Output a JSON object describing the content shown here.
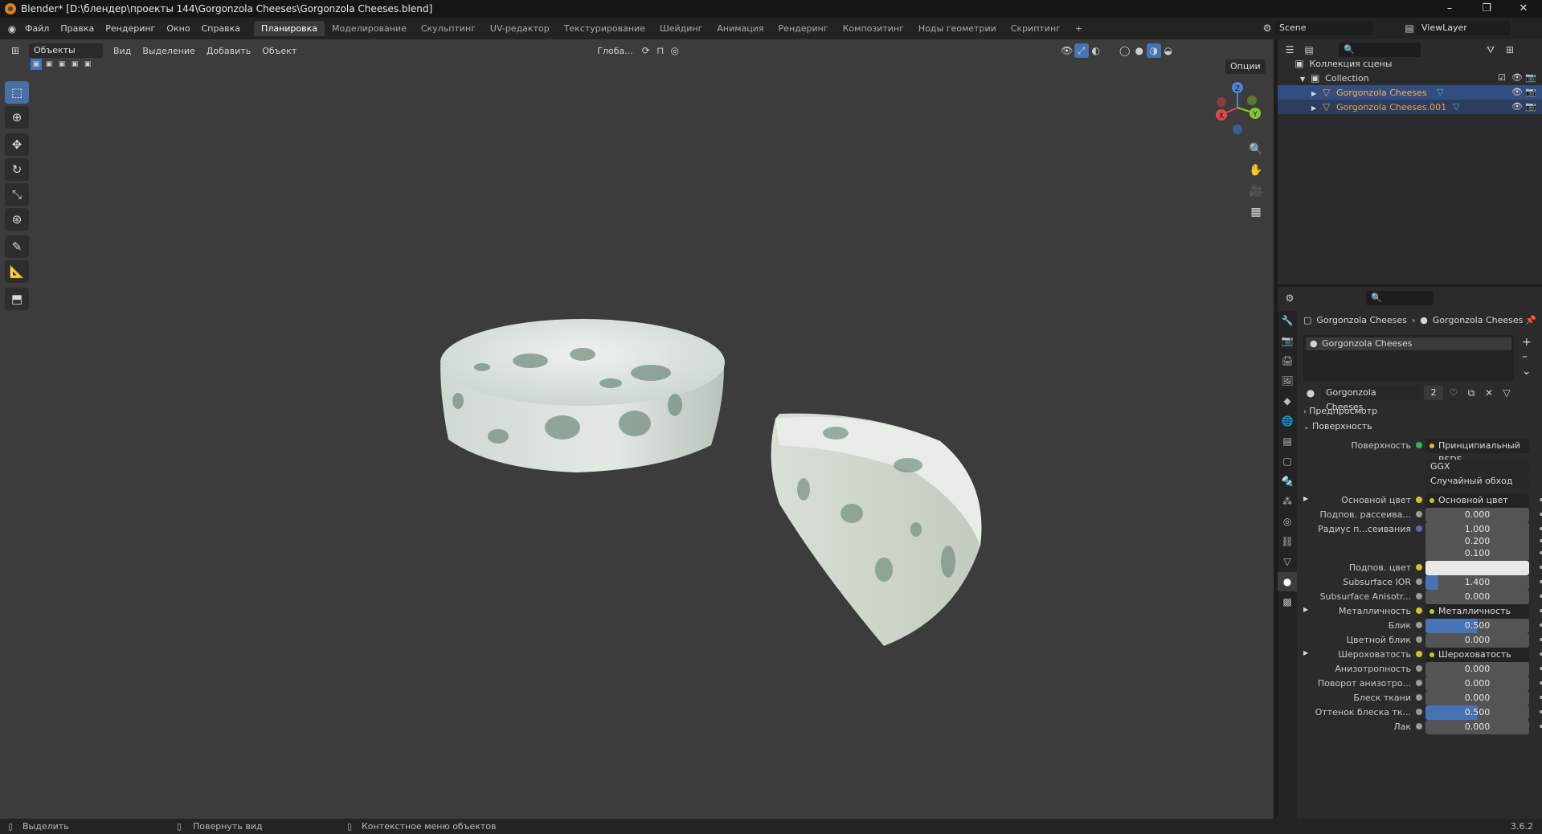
{
  "title": "Blender* [D:\\блендер\\проекты 144\\Gorgonzola Cheeses\\Gorgonzola Cheeses.blend]",
  "window_controls": {
    "minimize": "–",
    "restore": "❐",
    "close": "✕"
  },
  "menu": [
    "Файл",
    "Правка",
    "Рендеринг",
    "Окно",
    "Справка"
  ],
  "workspaces": [
    "Планировка",
    "Моделирование",
    "Скульптинг",
    "UV-редактор",
    "Текстурирование",
    "Шейдинг",
    "Анимация",
    "Рендеринг",
    "Композитинг",
    "Ноды геометрии",
    "Скриптинг",
    "+"
  ],
  "active_workspace": "Планировка",
  "scene": {
    "label": "Scene",
    "viewlayer": "ViewLayer"
  },
  "viewport": {
    "mode": "Объекты",
    "menu": [
      "Вид",
      "Выделение",
      "Добавить",
      "Объект"
    ],
    "orientation": "Глоба...",
    "options": "Опции",
    "gizmo_axes": {
      "z": "Z",
      "y": "Y",
      "x": "X"
    }
  },
  "outliner": {
    "root": "Коллекция сцены",
    "collection": "Collection",
    "objects": [
      "Gorgonzola Cheeses",
      "Gorgonzola Cheeses.001"
    ]
  },
  "properties": {
    "breadcrumb": [
      "Gorgonzola Cheeses",
      "Gorgonzola Cheeses"
    ],
    "material_slot": "Gorgonzola Cheeses",
    "material_name": "Gorgonzola Cheeses",
    "material_users": "2",
    "sections": {
      "preview": "Предпросмотр",
      "surface": "Поверхность"
    },
    "surface": {
      "label": "Поверхность",
      "value": "Принципиальный BSDF"
    },
    "distribution": "GGX",
    "subsurface_method": "Случайный обход",
    "rows": [
      {
        "label": "Основной цвет",
        "value": "Основной цвет",
        "kind": "node"
      },
      {
        "label": "Подпов. рассеива...",
        "value": "0.000",
        "kind": "num"
      },
      {
        "label": "Радиус п...сеивания",
        "value": "1.000",
        "kind": "num"
      },
      {
        "label": "",
        "value": "0.200",
        "kind": "num"
      },
      {
        "label": "",
        "value": "0.100",
        "kind": "num"
      },
      {
        "label": "Подпов. цвет",
        "value": "",
        "kind": "color"
      },
      {
        "label": "Subsurface IOR",
        "value": "1.400",
        "kind": "slider",
        "fill": 0.12
      },
      {
        "label": "Subsurface Anisotr...",
        "value": "0.000",
        "kind": "num"
      },
      {
        "label": "Металличность",
        "value": "Металличность",
        "kind": "node"
      },
      {
        "label": "Блик",
        "value": "0.500",
        "kind": "slider",
        "fill": 0.5
      },
      {
        "label": "Цветной блик",
        "value": "0.000",
        "kind": "num"
      },
      {
        "label": "Шероховатость",
        "value": "Шероховатость",
        "kind": "node"
      },
      {
        "label": "Анизотропность",
        "value": "0.000",
        "kind": "num"
      },
      {
        "label": "Поворот анизотро...",
        "value": "0.000",
        "kind": "num"
      },
      {
        "label": "Блеск ткани",
        "value": "0.000",
        "kind": "num"
      },
      {
        "label": "Оттенок блеска тк...",
        "value": "0.500",
        "kind": "slider",
        "fill": 0.5
      },
      {
        "label": "Лак",
        "value": "0.000",
        "kind": "num"
      }
    ]
  },
  "statusbar": {
    "select": "Выделить",
    "rotate": "Повернуть вид",
    "context": "Контекстное меню объектов",
    "version": "3.6.2"
  },
  "colors": {
    "accent": "#4772b3",
    "viewport_bg": "#3c3c3c",
    "panel_bg": "#2b2b2b",
    "object_orange": "#e8a04a"
  }
}
